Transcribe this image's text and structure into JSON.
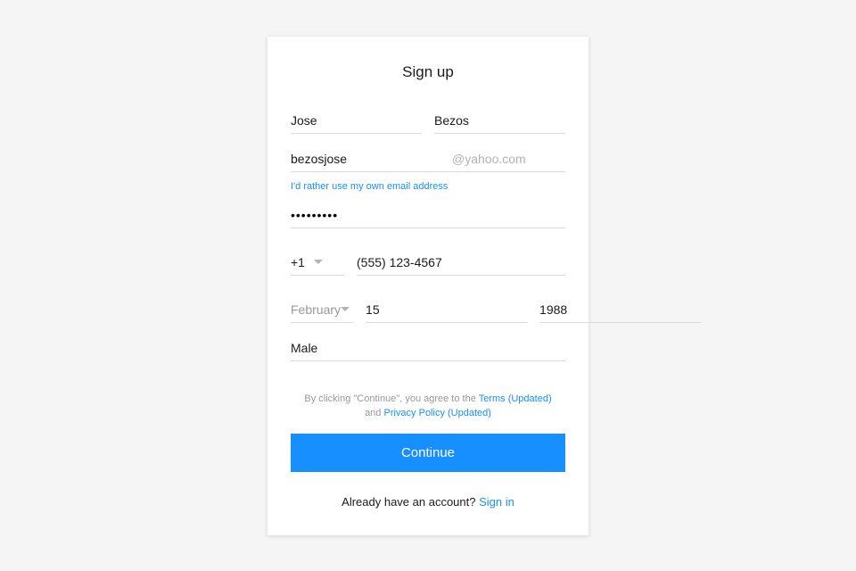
{
  "title": "Sign up",
  "first_name": "Jose",
  "last_name": "Bezos",
  "email_local": "bezosjose",
  "email_domain": "@yahoo.com",
  "own_email_link": "I'd rather use my own email address",
  "password": "•••••••••",
  "country_code": "+1",
  "phone": "(555) 123-4567",
  "dob": {
    "month": "February",
    "day": "15",
    "year": "1988"
  },
  "gender": "Male",
  "legal_prefix": "By clicking \"Continue\", you agree to the ",
  "legal_terms": "Terms (Updated)",
  "legal_and": " and ",
  "legal_privacy": "Privacy Policy (Updated)",
  "continue_label": "Continue",
  "signin_prompt": "Already have an account? ",
  "signin_link": "Sign in"
}
